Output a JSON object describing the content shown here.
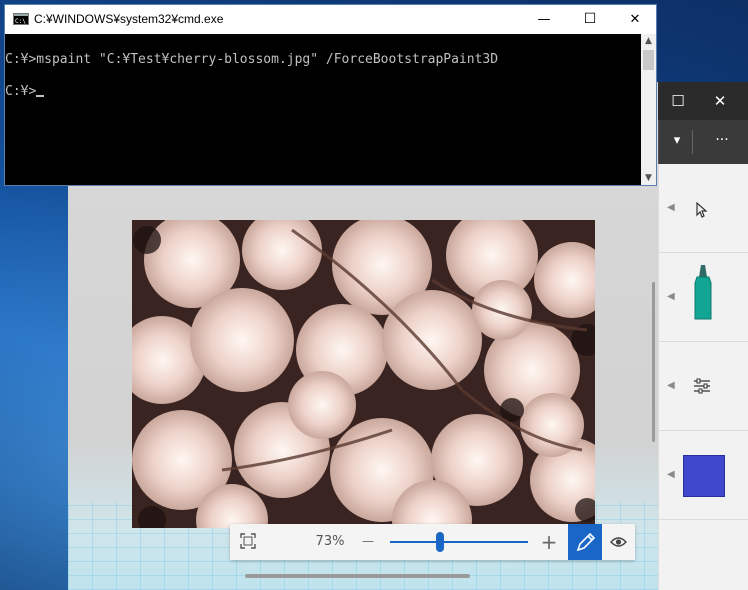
{
  "cmd": {
    "title": "C:¥WINDOWS¥system32¥cmd.exe",
    "line1": "C:¥>mspaint \"C:¥Test¥cherry-blossom.jpg\" /ForceBootstrapPaint3D",
    "line2": "C:¥>",
    "minimize": "—",
    "maximize": "☐",
    "close": "✕"
  },
  "paint": {
    "maximize": "☐",
    "close": "✕",
    "toolbar_dropdown": "▾",
    "toolbar_more": "···",
    "zoom_percent": "73%",
    "zoom_out": "—",
    "zoom_in": "+",
    "zoom_level": 0.73,
    "color_swatch": "#3f48cc"
  },
  "colors": {
    "accent": "#1a66c6",
    "teal_marker": "#12a593"
  }
}
